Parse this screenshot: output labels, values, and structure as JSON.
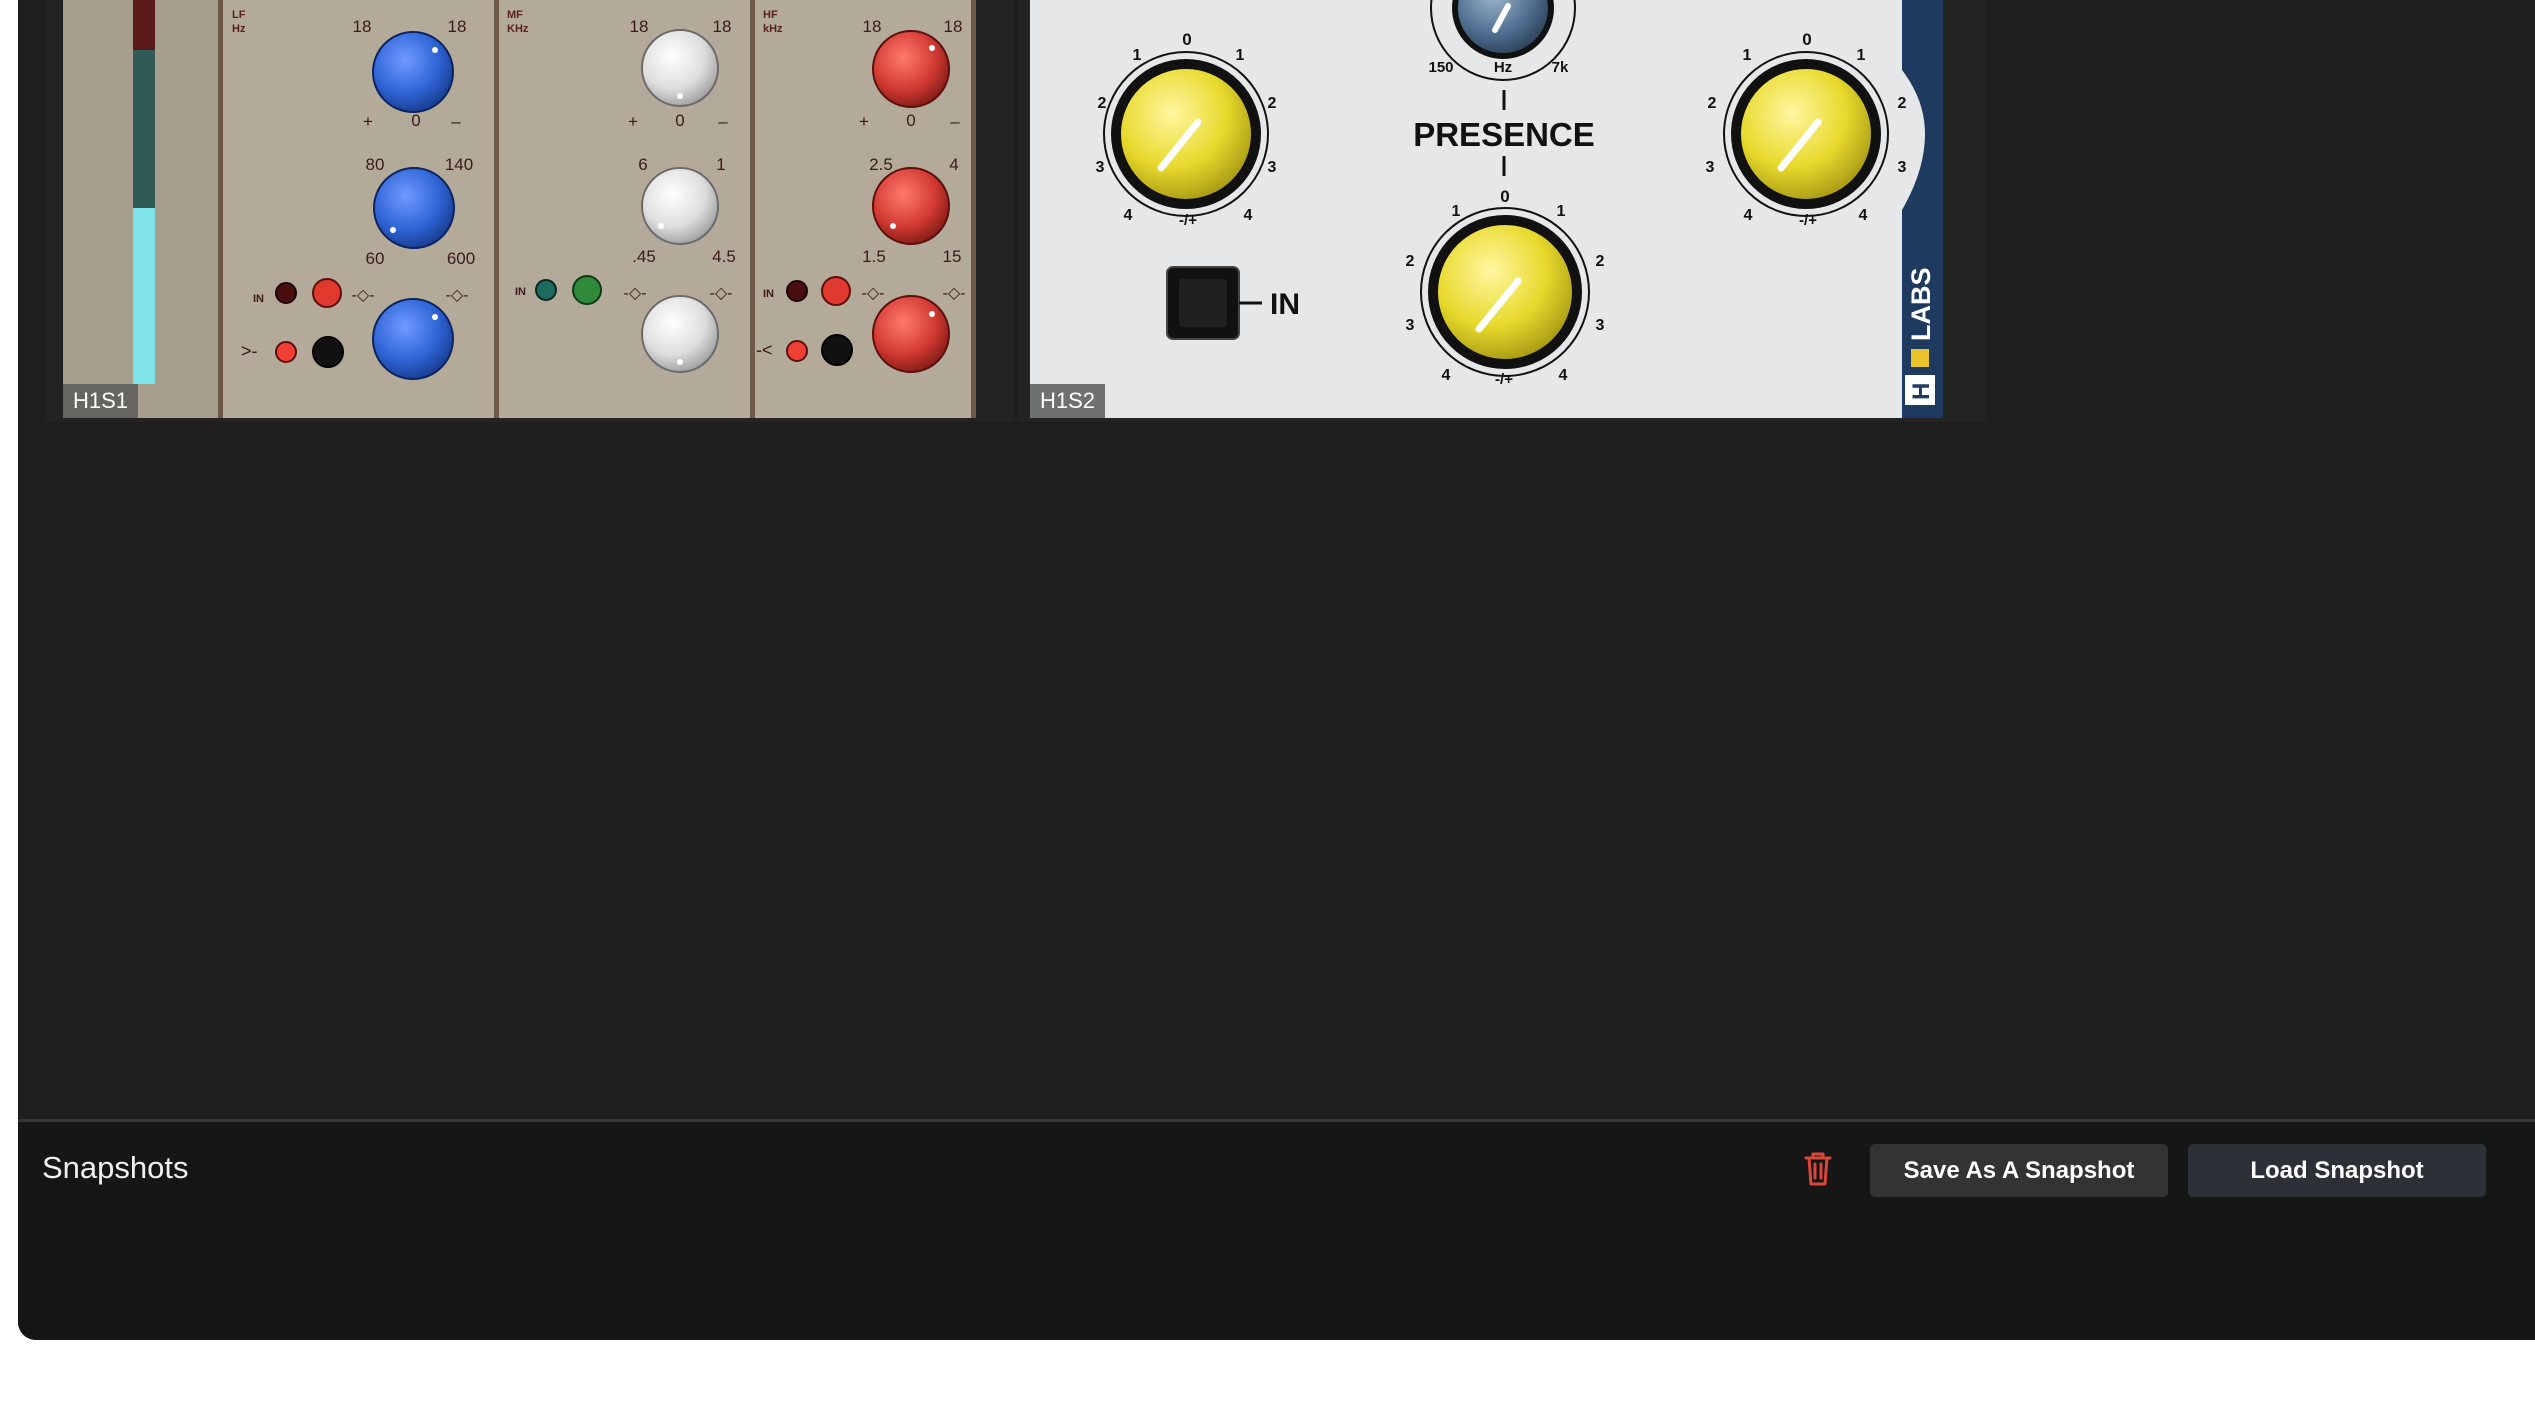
{
  "plugins": [
    {
      "label": "H1S1",
      "lf": {
        "title": "LF",
        "unit": "Hz",
        "gain_left": "18",
        "gain_right": "18",
        "gain_plus": "+",
        "gain_zero": "0",
        "gain_minus": "–",
        "freq_top_left": "80",
        "freq_top_right": "140",
        "freq_bottom_left": "60",
        "freq_bottom_right": "600",
        "in_label": "IN"
      },
      "mf": {
        "title": "MF",
        "unit": "KHz",
        "gain_left": "18",
        "gain_right": "18",
        "gain_plus": "+",
        "gain_zero": "0",
        "gain_minus": "–",
        "freq_top_left": "6",
        "freq_top_right": "1",
        "freq_bottom_left": ".45",
        "freq_bottom_right": "4.5",
        "in_label": "IN"
      },
      "hf": {
        "title": "HF",
        "unit": "kHz",
        "gain_left": "18",
        "gain_right": "18",
        "gain_plus": "+",
        "gain_zero": "0",
        "gain_minus": "–",
        "freq_top_left": "2.5",
        "freq_top_right": "4",
        "freq_bottom_left": "1.5",
        "freq_bottom_right": "15",
        "in_label": "IN"
      }
    },
    {
      "label": "H1S2",
      "presence_title": "PRESENCE",
      "in_label": "IN",
      "brand": "LABS",
      "freq_knob": {
        "left": "150",
        "center": "Hz",
        "right": "7k"
      },
      "scale": {
        "zero": "0",
        "one": "1",
        "two": "2",
        "three": "3",
        "four": "4",
        "center": "-/+"
      }
    }
  ],
  "snapshots": {
    "title": "Snapshots",
    "delete_icon": "trash-icon",
    "save_label": "Save As A Snapshot",
    "load_label": "Load Snapshot"
  },
  "colors": {
    "app_bg": "#1e1e1e",
    "panel_bg": "#161616",
    "delete_red": "#d9473b",
    "knob_blue": "#2f64d6",
    "knob_red": "#d23a32",
    "knob_white": "#e6e6e6",
    "knob_yellow": "#e8d92c",
    "meter_cyan": "#7fe3ea"
  }
}
